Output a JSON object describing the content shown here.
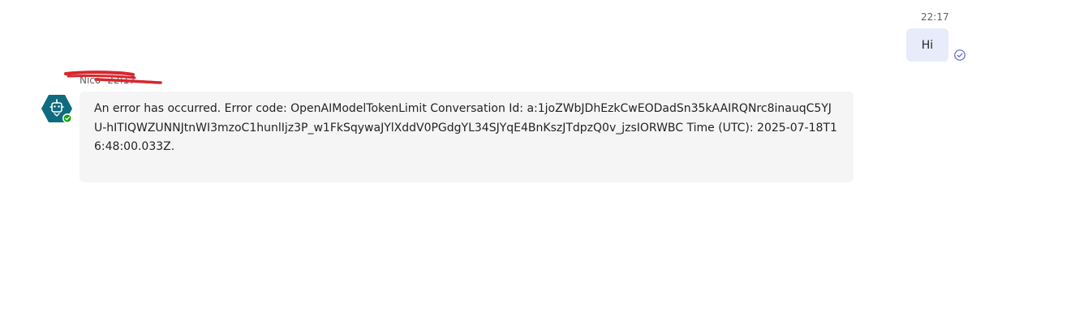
{
  "outgoing": {
    "time": "22:17",
    "text": "Hi",
    "receipt_icon": "read-receipt-check-icon"
  },
  "incoming": {
    "sender": "Nico",
    "time": "22:17",
    "avatar_icon": "bot-avatar-icon",
    "status_icon": "available-check-icon",
    "text": "An error has occurred. Error code: OpenAIModelTokenLimit Conversation Id: a:1joZWbJDhEzkCwEODadSn35kAAIRQNrc8inauqC5YJU-hITIQWZUNNJtnWI3mzoC1hunlIjz3P_w1FkSqywaJYlXddV0PGdgYL34SJYqE4BnKszJTdpzQ0v_jzsIORWBC Time (UTC): 2025-07-18T16:48:00.033Z."
  },
  "colors": {
    "outgoing_bubble": "#e8ebfa",
    "incoming_bubble": "#f5f5f5",
    "avatar": "#0f6b7f",
    "status": "#13a10e",
    "receipt": "#5b5fc7",
    "redaction": "#d9262c"
  }
}
